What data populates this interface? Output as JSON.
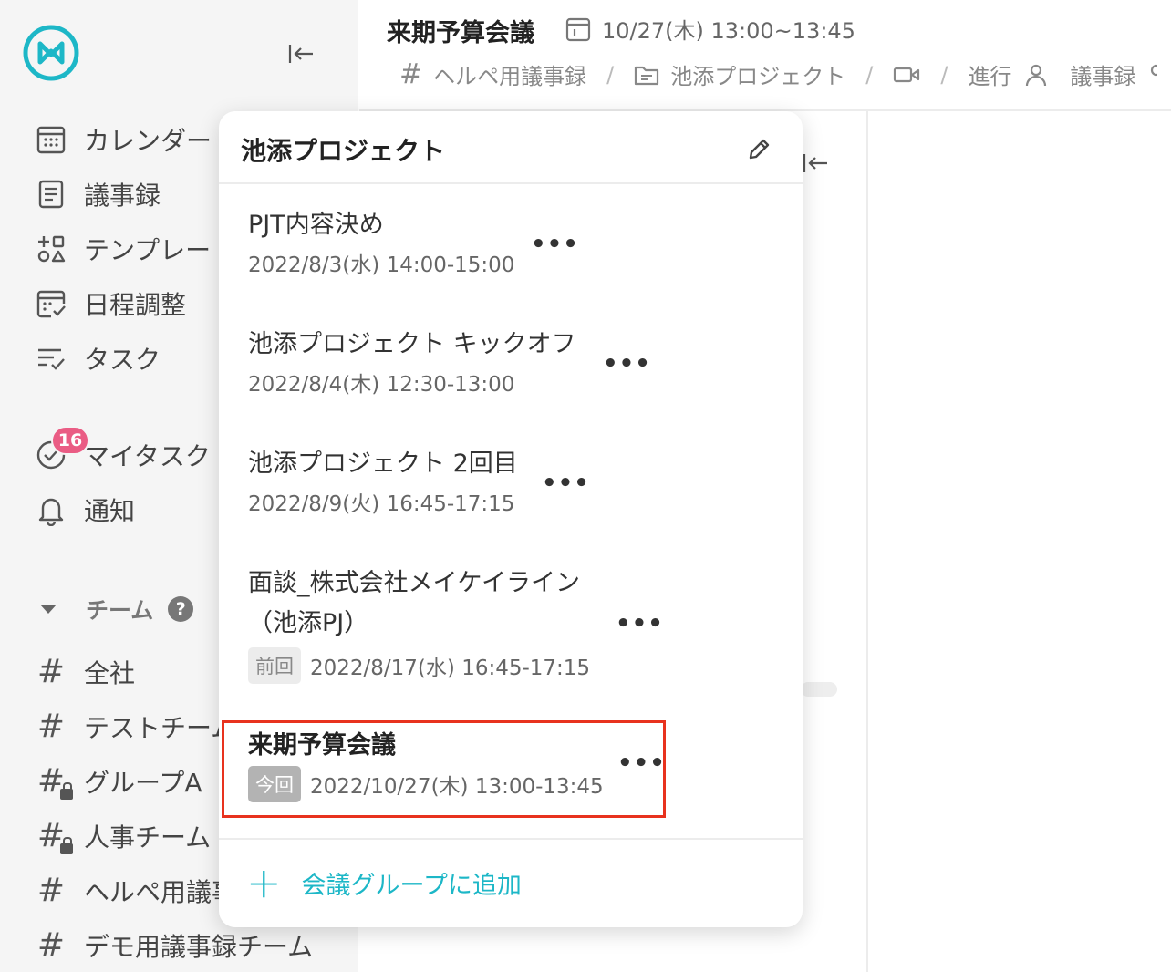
{
  "brand": {
    "accent": "#1db7c7",
    "badge_color": "#ea5c84",
    "highlight_color": "#e8321e"
  },
  "sidebar": {
    "nav": [
      {
        "label": "カレンダー",
        "icon": "calendar-icon"
      },
      {
        "label": "議事録",
        "icon": "document-icon"
      },
      {
        "label": "テンプレート",
        "icon": "template-icon"
      },
      {
        "label": "日程調整",
        "icon": "schedule-icon"
      },
      {
        "label": "タスク",
        "icon": "tasks-icon"
      }
    ],
    "mytask": {
      "label": "マイタスク",
      "badge": "16",
      "icon": "check-circle-icon"
    },
    "notifications": {
      "label": "通知",
      "icon": "bell-icon"
    },
    "team_header": {
      "label": "チーム",
      "help": "?"
    },
    "teams": [
      {
        "label": "全社",
        "locked": false
      },
      {
        "label": "テストチーム",
        "locked": false
      },
      {
        "label": "グループA",
        "locked": true
      },
      {
        "label": "人事チーム",
        "locked": true
      },
      {
        "label": "ヘルペ用議事録",
        "locked": false
      },
      {
        "label": "デモ用議事録チーム",
        "locked": false
      }
    ]
  },
  "header": {
    "title": "来期予算会議",
    "datetime": "10/27(木) 13:00~13:45",
    "breadcrumb": {
      "team": "ヘルペ用議事録",
      "project": "池添プロジェクト",
      "progress": "進行",
      "minutes": "議事録"
    }
  },
  "popover": {
    "title": "池添プロジェクト",
    "meetings": [
      {
        "name": "PJT内容決め",
        "datetime": "2022/8/3(水) 14:00-15:00",
        "tag": ""
      },
      {
        "name": "池添プロジェクト キックオフ",
        "datetime": "2022/8/4(木) 12:30-13:00",
        "tag": ""
      },
      {
        "name": "池添プロジェクト 2回目",
        "datetime": "2022/8/9(火) 16:45-17:15",
        "tag": ""
      },
      {
        "name_line1": "面談_株式会社メイケイライン",
        "name_line2": "（池添PJ）",
        "datetime": "2022/8/17(水) 16:45-17:15",
        "tag": "前回"
      },
      {
        "name": "来期予算会議",
        "datetime": "2022/10/27(木) 13:00-13:45",
        "tag": "今回"
      }
    ],
    "more_label": "•••",
    "add_label": "会議グループに追加"
  }
}
